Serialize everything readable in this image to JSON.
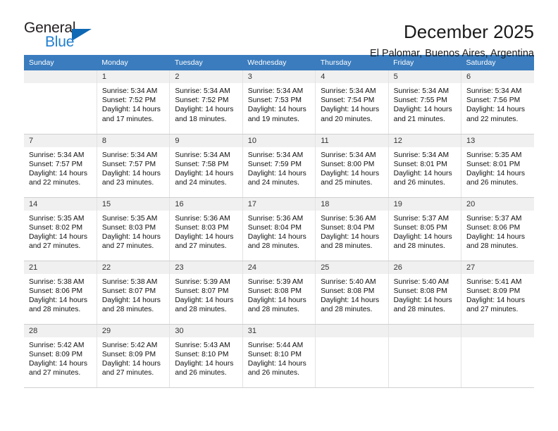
{
  "brand": {
    "name_top": "General",
    "name_bottom": "Blue",
    "accent_color": "#0f68b4",
    "text_color": "#231f20"
  },
  "header": {
    "title": "December 2025",
    "subtitle": "El Palomar, Buenos Aires, Argentina"
  },
  "calendar": {
    "header_bg": "#3a7cbe",
    "weekdays": [
      "Sunday",
      "Monday",
      "Tuesday",
      "Wednesday",
      "Thursday",
      "Friday",
      "Saturday"
    ],
    "weeks": [
      [
        {
          "day": "",
          "sunrise": "",
          "sunset": "",
          "daylight1": "",
          "daylight2": "",
          "empty": true
        },
        {
          "day": "1",
          "sunrise": "Sunrise: 5:34 AM",
          "sunset": "Sunset: 7:52 PM",
          "daylight1": "Daylight: 14 hours",
          "daylight2": "and 17 minutes.",
          "empty": false
        },
        {
          "day": "2",
          "sunrise": "Sunrise: 5:34 AM",
          "sunset": "Sunset: 7:52 PM",
          "daylight1": "Daylight: 14 hours",
          "daylight2": "and 18 minutes.",
          "empty": false
        },
        {
          "day": "3",
          "sunrise": "Sunrise: 5:34 AM",
          "sunset": "Sunset: 7:53 PM",
          "daylight1": "Daylight: 14 hours",
          "daylight2": "and 19 minutes.",
          "empty": false
        },
        {
          "day": "4",
          "sunrise": "Sunrise: 5:34 AM",
          "sunset": "Sunset: 7:54 PM",
          "daylight1": "Daylight: 14 hours",
          "daylight2": "and 20 minutes.",
          "empty": false
        },
        {
          "day": "5",
          "sunrise": "Sunrise: 5:34 AM",
          "sunset": "Sunset: 7:55 PM",
          "daylight1": "Daylight: 14 hours",
          "daylight2": "and 21 minutes.",
          "empty": false
        },
        {
          "day": "6",
          "sunrise": "Sunrise: 5:34 AM",
          "sunset": "Sunset: 7:56 PM",
          "daylight1": "Daylight: 14 hours",
          "daylight2": "and 22 minutes.",
          "empty": false
        }
      ],
      [
        {
          "day": "7",
          "sunrise": "Sunrise: 5:34 AM",
          "sunset": "Sunset: 7:57 PM",
          "daylight1": "Daylight: 14 hours",
          "daylight2": "and 22 minutes.",
          "empty": false
        },
        {
          "day": "8",
          "sunrise": "Sunrise: 5:34 AM",
          "sunset": "Sunset: 7:57 PM",
          "daylight1": "Daylight: 14 hours",
          "daylight2": "and 23 minutes.",
          "empty": false
        },
        {
          "day": "9",
          "sunrise": "Sunrise: 5:34 AM",
          "sunset": "Sunset: 7:58 PM",
          "daylight1": "Daylight: 14 hours",
          "daylight2": "and 24 minutes.",
          "empty": false
        },
        {
          "day": "10",
          "sunrise": "Sunrise: 5:34 AM",
          "sunset": "Sunset: 7:59 PM",
          "daylight1": "Daylight: 14 hours",
          "daylight2": "and 24 minutes.",
          "empty": false
        },
        {
          "day": "11",
          "sunrise": "Sunrise: 5:34 AM",
          "sunset": "Sunset: 8:00 PM",
          "daylight1": "Daylight: 14 hours",
          "daylight2": "and 25 minutes.",
          "empty": false
        },
        {
          "day": "12",
          "sunrise": "Sunrise: 5:34 AM",
          "sunset": "Sunset: 8:01 PM",
          "daylight1": "Daylight: 14 hours",
          "daylight2": "and 26 minutes.",
          "empty": false
        },
        {
          "day": "13",
          "sunrise": "Sunrise: 5:35 AM",
          "sunset": "Sunset: 8:01 PM",
          "daylight1": "Daylight: 14 hours",
          "daylight2": "and 26 minutes.",
          "empty": false
        }
      ],
      [
        {
          "day": "14",
          "sunrise": "Sunrise: 5:35 AM",
          "sunset": "Sunset: 8:02 PM",
          "daylight1": "Daylight: 14 hours",
          "daylight2": "and 27 minutes.",
          "empty": false
        },
        {
          "day": "15",
          "sunrise": "Sunrise: 5:35 AM",
          "sunset": "Sunset: 8:03 PM",
          "daylight1": "Daylight: 14 hours",
          "daylight2": "and 27 minutes.",
          "empty": false
        },
        {
          "day": "16",
          "sunrise": "Sunrise: 5:36 AM",
          "sunset": "Sunset: 8:03 PM",
          "daylight1": "Daylight: 14 hours",
          "daylight2": "and 27 minutes.",
          "empty": false
        },
        {
          "day": "17",
          "sunrise": "Sunrise: 5:36 AM",
          "sunset": "Sunset: 8:04 PM",
          "daylight1": "Daylight: 14 hours",
          "daylight2": "and 28 minutes.",
          "empty": false
        },
        {
          "day": "18",
          "sunrise": "Sunrise: 5:36 AM",
          "sunset": "Sunset: 8:04 PM",
          "daylight1": "Daylight: 14 hours",
          "daylight2": "and 28 minutes.",
          "empty": false
        },
        {
          "day": "19",
          "sunrise": "Sunrise: 5:37 AM",
          "sunset": "Sunset: 8:05 PM",
          "daylight1": "Daylight: 14 hours",
          "daylight2": "and 28 minutes.",
          "empty": false
        },
        {
          "day": "20",
          "sunrise": "Sunrise: 5:37 AM",
          "sunset": "Sunset: 8:06 PM",
          "daylight1": "Daylight: 14 hours",
          "daylight2": "and 28 minutes.",
          "empty": false
        }
      ],
      [
        {
          "day": "21",
          "sunrise": "Sunrise: 5:38 AM",
          "sunset": "Sunset: 8:06 PM",
          "daylight1": "Daylight: 14 hours",
          "daylight2": "and 28 minutes.",
          "empty": false
        },
        {
          "day": "22",
          "sunrise": "Sunrise: 5:38 AM",
          "sunset": "Sunset: 8:07 PM",
          "daylight1": "Daylight: 14 hours",
          "daylight2": "and 28 minutes.",
          "empty": false
        },
        {
          "day": "23",
          "sunrise": "Sunrise: 5:39 AM",
          "sunset": "Sunset: 8:07 PM",
          "daylight1": "Daylight: 14 hours",
          "daylight2": "and 28 minutes.",
          "empty": false
        },
        {
          "day": "24",
          "sunrise": "Sunrise: 5:39 AM",
          "sunset": "Sunset: 8:08 PM",
          "daylight1": "Daylight: 14 hours",
          "daylight2": "and 28 minutes.",
          "empty": false
        },
        {
          "day": "25",
          "sunrise": "Sunrise: 5:40 AM",
          "sunset": "Sunset: 8:08 PM",
          "daylight1": "Daylight: 14 hours",
          "daylight2": "and 28 minutes.",
          "empty": false
        },
        {
          "day": "26",
          "sunrise": "Sunrise: 5:40 AM",
          "sunset": "Sunset: 8:08 PM",
          "daylight1": "Daylight: 14 hours",
          "daylight2": "and 28 minutes.",
          "empty": false
        },
        {
          "day": "27",
          "sunrise": "Sunrise: 5:41 AM",
          "sunset": "Sunset: 8:09 PM",
          "daylight1": "Daylight: 14 hours",
          "daylight2": "and 27 minutes.",
          "empty": false
        }
      ],
      [
        {
          "day": "28",
          "sunrise": "Sunrise: 5:42 AM",
          "sunset": "Sunset: 8:09 PM",
          "daylight1": "Daylight: 14 hours",
          "daylight2": "and 27 minutes.",
          "empty": false
        },
        {
          "day": "29",
          "sunrise": "Sunrise: 5:42 AM",
          "sunset": "Sunset: 8:09 PM",
          "daylight1": "Daylight: 14 hours",
          "daylight2": "and 27 minutes.",
          "empty": false
        },
        {
          "day": "30",
          "sunrise": "Sunrise: 5:43 AM",
          "sunset": "Sunset: 8:10 PM",
          "daylight1": "Daylight: 14 hours",
          "daylight2": "and 26 minutes.",
          "empty": false
        },
        {
          "day": "31",
          "sunrise": "Sunrise: 5:44 AM",
          "sunset": "Sunset: 8:10 PM",
          "daylight1": "Daylight: 14 hours",
          "daylight2": "and 26 minutes.",
          "empty": false
        },
        {
          "day": "",
          "sunrise": "",
          "sunset": "",
          "daylight1": "",
          "daylight2": "",
          "empty": true
        },
        {
          "day": "",
          "sunrise": "",
          "sunset": "",
          "daylight1": "",
          "daylight2": "",
          "empty": true
        },
        {
          "day": "",
          "sunrise": "",
          "sunset": "",
          "daylight1": "",
          "daylight2": "",
          "empty": true
        }
      ]
    ]
  }
}
